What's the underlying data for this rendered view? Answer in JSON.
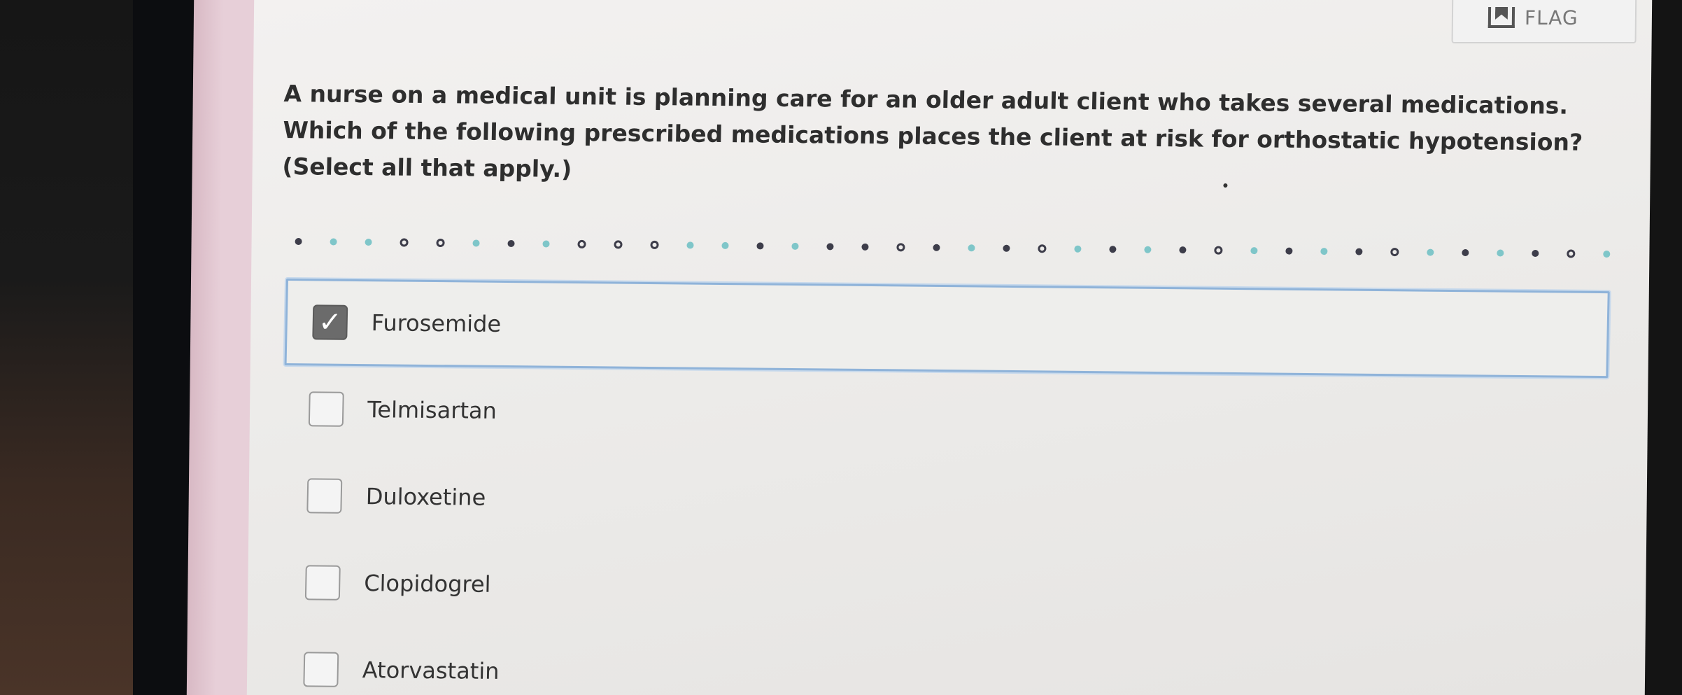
{
  "header": {
    "flag_label": "FLAG"
  },
  "question": {
    "text": "A nurse on a medical unit is planning care for an older adult client who takes several medications. Which of the following prescribed medications places the client at risk for orthostatic hypotension? (Select all that apply.)"
  },
  "progress_dots": [
    "dark",
    "teal",
    "teal",
    "ring",
    "ring",
    "teal",
    "dark",
    "teal",
    "ring",
    "ring",
    "ring",
    "teal",
    "teal",
    "dark",
    "teal",
    "dark",
    "dark",
    "ring",
    "dark",
    "teal",
    "dark",
    "ring",
    "teal",
    "dark",
    "teal",
    "dark",
    "ring",
    "teal",
    "dark",
    "teal",
    "dark",
    "ring",
    "teal",
    "dark",
    "teal",
    "dark",
    "ring",
    "teal"
  ],
  "options": [
    {
      "label": "Furosemide",
      "checked": true
    },
    {
      "label": "Telmisartan",
      "checked": false
    },
    {
      "label": "Duloxetine",
      "checked": false
    },
    {
      "label": "Clopidogrel",
      "checked": false
    },
    {
      "label": "Atorvastatin",
      "checked": false
    }
  ],
  "colors": {
    "selected_border": "#8fb3d9",
    "checkbox_checked": "#6b6b6b",
    "dot_dark": "#3d3d4a",
    "dot_teal": "#7fc6c9"
  }
}
